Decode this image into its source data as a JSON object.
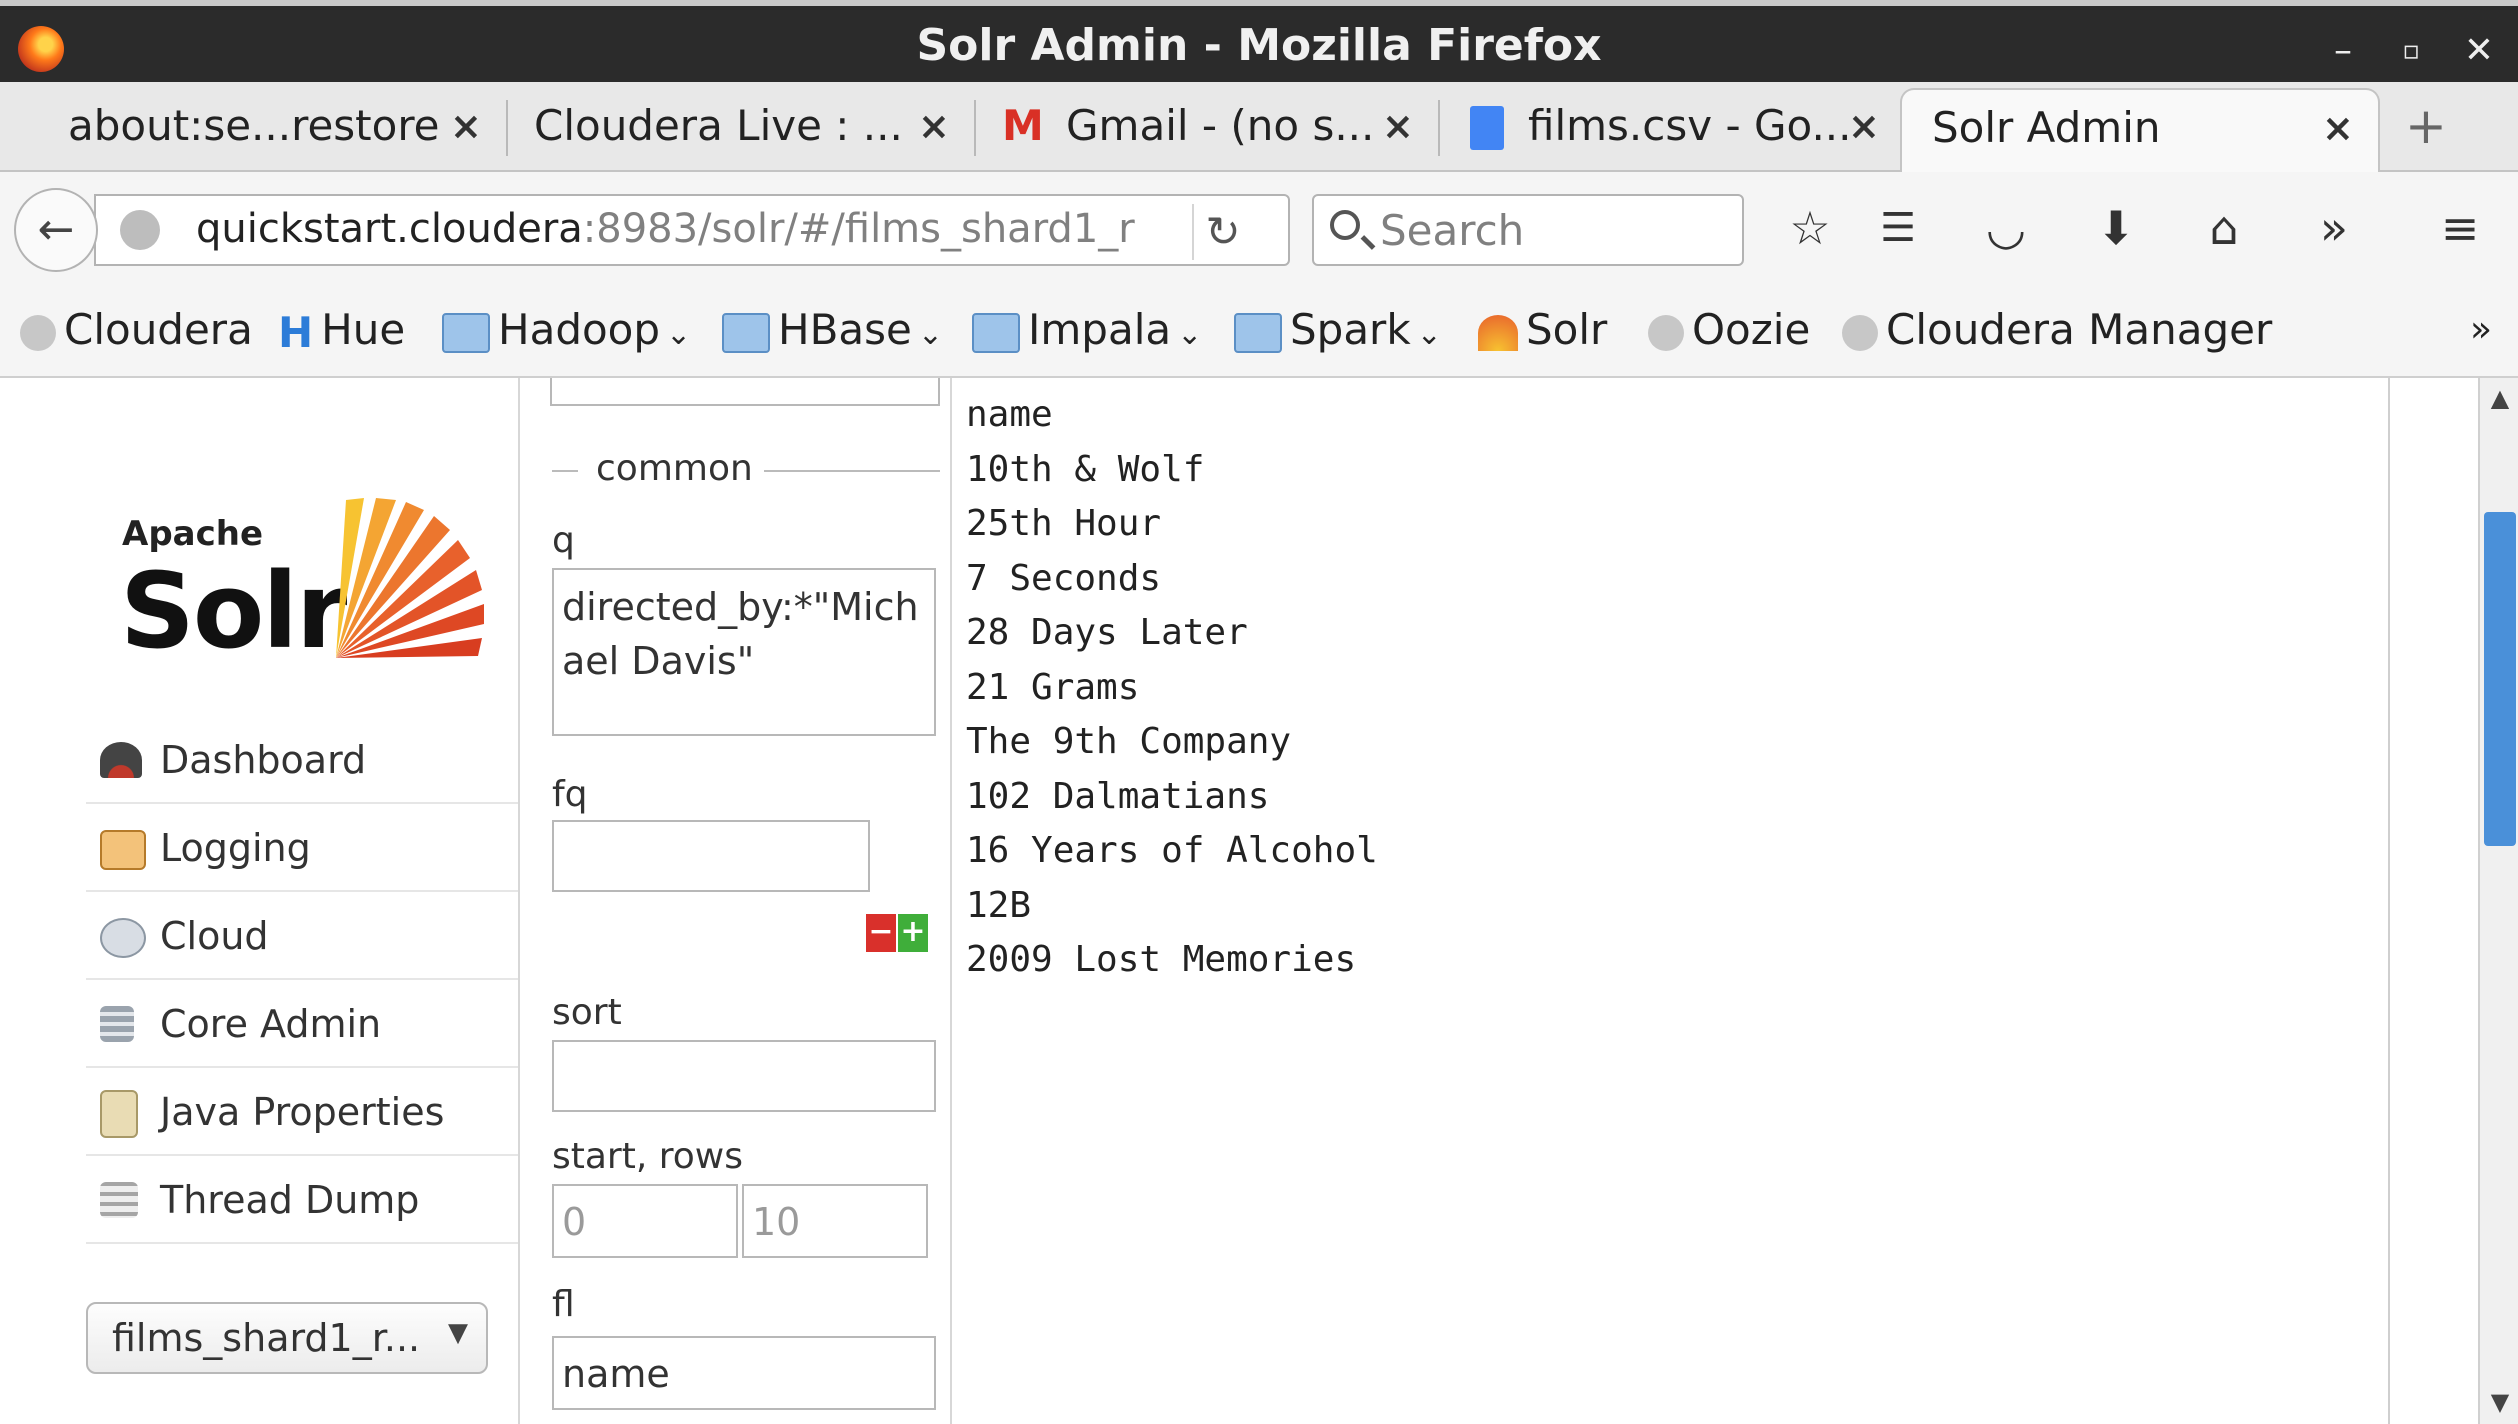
{
  "window": {
    "title": "Solr Admin - Mozilla Firefox"
  },
  "tabs": [
    {
      "label": "about:se...restore"
    },
    {
      "label": "Cloudera Live : ..."
    },
    {
      "label": "Gmail - (no s..."
    },
    {
      "label": "films.csv - Go..."
    },
    {
      "label": "Solr Admin",
      "active": true
    }
  ],
  "tab_close_glyph": "×",
  "new_tab_glyph": "+",
  "url": {
    "host": "quickstart.cloudera",
    "path": ":8983/solr/#/films_shard1_r"
  },
  "search": {
    "placeholder": "Search"
  },
  "bookmarks": [
    {
      "label": "Cloudera",
      "icon": "globe-icon"
    },
    {
      "label": "Hue",
      "icon": "hue-icon"
    },
    {
      "label": "Hadoop",
      "icon": "folder-icon",
      "dropdown": true
    },
    {
      "label": "HBase",
      "icon": "folder-icon",
      "dropdown": true
    },
    {
      "label": "Impala",
      "icon": "folder-icon",
      "dropdown": true
    },
    {
      "label": "Spark",
      "icon": "folder-icon",
      "dropdown": true
    },
    {
      "label": "Solr",
      "icon": "solr-icon"
    },
    {
      "label": "Oozie",
      "icon": "globe-icon"
    },
    {
      "label": "Cloudera Manager",
      "icon": "globe-icon"
    }
  ],
  "logo": {
    "small": "Apache",
    "big": "Solr"
  },
  "sidebar": {
    "items": [
      {
        "label": "Dashboard",
        "icon": "dashboard-icon"
      },
      {
        "label": "Logging",
        "icon": "logging-icon"
      },
      {
        "label": "Cloud",
        "icon": "cloud-icon"
      },
      {
        "label": "Core Admin",
        "icon": "core-admin-icon"
      },
      {
        "label": "Java Properties",
        "icon": "java-properties-icon"
      },
      {
        "label": "Thread Dump",
        "icon": "thread-dump-icon"
      }
    ],
    "core_selector": "films_shard1_r..."
  },
  "query_form": {
    "section": "common",
    "q_label": "q",
    "q_value": "directed_by:*\"Michael Davis\"",
    "fq_label": "fq",
    "fq_value": "",
    "sort_label": "sort",
    "sort_value": "",
    "start_rows_label": "start, rows",
    "start_placeholder": "0",
    "rows_placeholder": "10",
    "fl_label": "fl",
    "fl_value": "name"
  },
  "results": [
    "name",
    "10th & Wolf",
    "25th Hour",
    "7 Seconds",
    "28 Days Later",
    "21 Grams",
    "The 9th Company",
    "102 Dalmatians",
    "16 Years of Alcohol",
    "12B",
    "2009 Lost Memories"
  ],
  "colors": {
    "titlebar": "#2b2b2b",
    "scroll_thumb": "#4a90d9",
    "solr_orange": "#e8612c"
  }
}
